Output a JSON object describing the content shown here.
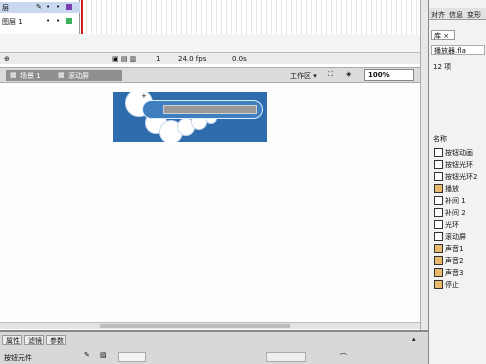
{
  "timeline": {
    "layers": [
      {
        "name": "层",
        "active": true
      },
      {
        "name": "图层 1",
        "active": false
      }
    ],
    "status": {
      "frame": "1",
      "fps": "24.0 fps",
      "time": "0.0s"
    }
  },
  "editbar": {
    "scene1": "场景 1",
    "scene2": "滚动屏",
    "workspace": "工作区 ▾",
    "zoom": "100%"
  },
  "properties": {
    "tabs": [
      "属性",
      "滤镜",
      "参数"
    ],
    "label": "按钮元件"
  },
  "right_panel": {
    "tabs": [
      "对齐",
      "信息",
      "变形"
    ],
    "library_tab": "库 ×",
    "file": "播放器.fla",
    "count": "12 项",
    "name_header": "名称",
    "items": [
      {
        "label": "按钮动画",
        "icon": "button-symbol-icon"
      },
      {
        "label": "按钮光环",
        "icon": "button-symbol-icon"
      },
      {
        "label": "按钮光环2",
        "icon": "button-symbol-icon"
      },
      {
        "label": "播放",
        "icon": "sound-icon"
      },
      {
        "label": "补间 1",
        "icon": "graphic-symbol-icon"
      },
      {
        "label": "补间 2",
        "icon": "graphic-symbol-icon"
      },
      {
        "label": "光环",
        "icon": "graphic-symbol-icon"
      },
      {
        "label": "滚动屏",
        "icon": "movieclip-symbol-icon"
      },
      {
        "label": "声音1",
        "icon": "sound-icon"
      },
      {
        "label": "声音2",
        "icon": "sound-icon"
      },
      {
        "label": "声音3",
        "icon": "sound-icon"
      },
      {
        "label": "停止",
        "icon": "sound-icon"
      }
    ]
  }
}
